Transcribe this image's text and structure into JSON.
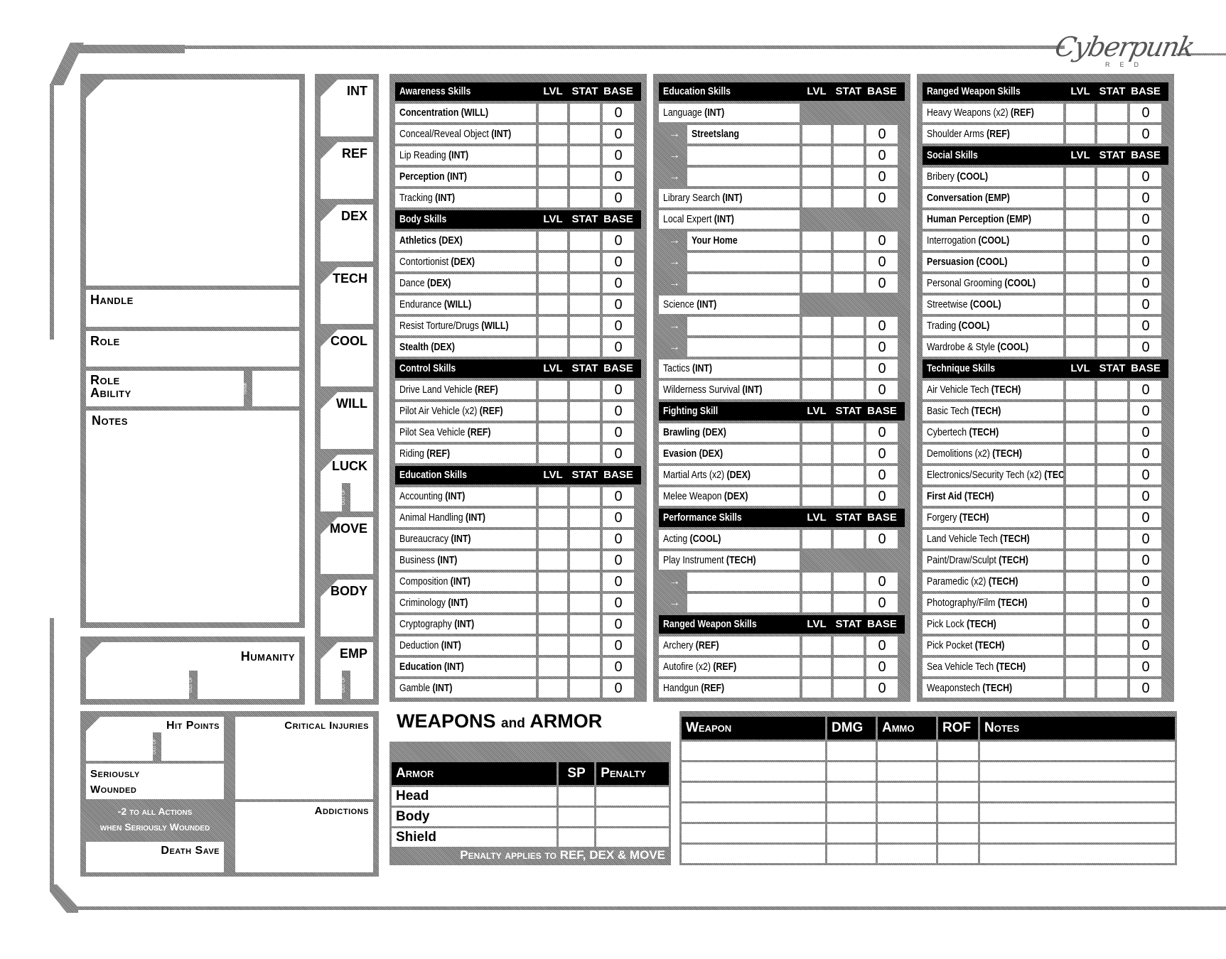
{
  "brand": {
    "logo": "Cyberpunk",
    "subtitle": "RED"
  },
  "character": {
    "handle_label": "Handle",
    "role_label": "Role",
    "role_ability_label": "Role Ability",
    "rank_label": "RANK",
    "notes_label": "Notes",
    "humanity_label": "Humanity",
    "out_of_label": "OUT OF"
  },
  "stats": [
    {
      "key": "INT",
      "out_of": false
    },
    {
      "key": "REF",
      "out_of": false
    },
    {
      "key": "DEX",
      "out_of": false
    },
    {
      "key": "TECH",
      "out_of": false
    },
    {
      "key": "COOL",
      "out_of": false
    },
    {
      "key": "WILL",
      "out_of": false
    },
    {
      "key": "LUCK",
      "out_of": true
    },
    {
      "key": "MOVE",
      "out_of": false
    },
    {
      "key": "BODY",
      "out_of": false
    },
    {
      "key": "EMP",
      "out_of": true
    }
  ],
  "columns_header": {
    "lvl": "LVL",
    "stat": "STAT",
    "base": "BASE"
  },
  "skill_columns": [
    [
      {
        "type": "header",
        "label": "Awareness Skills"
      },
      {
        "type": "skill",
        "name": "Concentration",
        "stat": "(WILL)",
        "bold": true,
        "base": "0"
      },
      {
        "type": "skill",
        "name": "Conceal/Reveal Object",
        "stat": "(INT)",
        "bold": false,
        "base": "0"
      },
      {
        "type": "skill",
        "name": "Lip Reading",
        "stat": "(INT)",
        "bold": false,
        "base": "0"
      },
      {
        "type": "skill",
        "name": "Perception",
        "stat": "(INT)",
        "bold": true,
        "base": "0"
      },
      {
        "type": "skill",
        "name": "Tracking",
        "stat": "(INT)",
        "bold": false,
        "base": "0"
      },
      {
        "type": "header",
        "label": "Body Skills"
      },
      {
        "type": "skill",
        "name": "Athletics",
        "stat": "(DEX)",
        "bold": true,
        "base": "0"
      },
      {
        "type": "skill",
        "name": "Contortionist",
        "stat": "(DEX)",
        "bold": false,
        "base": "0"
      },
      {
        "type": "skill",
        "name": "Dance",
        "stat": "(DEX)",
        "bold": false,
        "base": "0"
      },
      {
        "type": "skill",
        "name": "Endurance",
        "stat": "(WILL)",
        "bold": false,
        "base": "0"
      },
      {
        "type": "skill",
        "name": "Resist Torture/Drugs",
        "stat": "(WILL)",
        "bold": false,
        "base": "0"
      },
      {
        "type": "skill",
        "name": "Stealth",
        "stat": "(DEX)",
        "bold": true,
        "base": "0"
      },
      {
        "type": "header",
        "label": "Control Skills"
      },
      {
        "type": "skill",
        "name": "Drive Land Vehicle",
        "stat": "(REF)",
        "bold": false,
        "base": "0"
      },
      {
        "type": "skill",
        "name": "Pilot Air Vehicle (x2)",
        "stat": "(REF)",
        "bold": false,
        "base": "0"
      },
      {
        "type": "skill",
        "name": "Pilot Sea Vehicle",
        "stat": "(REF)",
        "bold": false,
        "base": "0"
      },
      {
        "type": "skill",
        "name": "Riding",
        "stat": "(REF)",
        "bold": false,
        "base": "0"
      },
      {
        "type": "header",
        "label": "Education Skills"
      },
      {
        "type": "skill",
        "name": "Accounting",
        "stat": "(INT)",
        "bold": false,
        "base": "0"
      },
      {
        "type": "skill",
        "name": "Animal Handling",
        "stat": "(INT)",
        "bold": false,
        "base": "0"
      },
      {
        "type": "skill",
        "name": "Bureaucracy",
        "stat": "(INT)",
        "bold": false,
        "base": "0"
      },
      {
        "type": "skill",
        "name": "Business",
        "stat": "(INT)",
        "bold": false,
        "base": "0"
      },
      {
        "type": "skill",
        "name": "Composition",
        "stat": "(INT)",
        "bold": false,
        "base": "0"
      },
      {
        "type": "skill",
        "name": "Criminology",
        "stat": "(INT)",
        "bold": false,
        "base": "0"
      },
      {
        "type": "skill",
        "name": "Cryptography",
        "stat": "(INT)",
        "bold": false,
        "base": "0"
      },
      {
        "type": "skill",
        "name": "Deduction",
        "stat": "(INT)",
        "bold": false,
        "base": "0"
      },
      {
        "type": "skill",
        "name": "Education",
        "stat": "(INT)",
        "bold": true,
        "base": "0"
      },
      {
        "type": "skill",
        "name": "Gamble",
        "stat": "(INT)",
        "bold": false,
        "base": "0"
      }
    ],
    [
      {
        "type": "header",
        "label": "Education Skills"
      },
      {
        "type": "parent",
        "name": "Language",
        "stat": "(INT)"
      },
      {
        "type": "sub",
        "name": "Streetslang",
        "base": "0"
      },
      {
        "type": "sub",
        "name": "",
        "base": "0"
      },
      {
        "type": "sub",
        "name": "",
        "base": "0"
      },
      {
        "type": "skill",
        "name": "Library Search",
        "stat": "(INT)",
        "bold": false,
        "base": "0"
      },
      {
        "type": "parent",
        "name": "Local Expert",
        "stat": "(INT)"
      },
      {
        "type": "sub",
        "name": "Your Home",
        "base": "0"
      },
      {
        "type": "sub",
        "name": "",
        "base": "0"
      },
      {
        "type": "sub",
        "name": "",
        "base": "0"
      },
      {
        "type": "parent",
        "name": "Science",
        "stat": "(INT)"
      },
      {
        "type": "sub",
        "name": "",
        "base": "0"
      },
      {
        "type": "sub",
        "name": "",
        "base": "0"
      },
      {
        "type": "skill",
        "name": "Tactics",
        "stat": "(INT)",
        "bold": false,
        "base": "0"
      },
      {
        "type": "skill",
        "name": "Wilderness Survival",
        "stat": "(INT)",
        "bold": false,
        "base": "0"
      },
      {
        "type": "header",
        "label": "Fighting Skill"
      },
      {
        "type": "skill",
        "name": "Brawling",
        "stat": "(DEX)",
        "bold": true,
        "base": "0"
      },
      {
        "type": "skill",
        "name": "Evasion",
        "stat": "(DEX)",
        "bold": true,
        "base": "0"
      },
      {
        "type": "skill",
        "name": "Martial Arts (x2)",
        "stat": "(DEX)",
        "bold": false,
        "base": "0"
      },
      {
        "type": "skill",
        "name": "Melee Weapon",
        "stat": "(DEX)",
        "bold": false,
        "base": "0"
      },
      {
        "type": "header",
        "label": "Performance Skills"
      },
      {
        "type": "skill",
        "name": "Acting",
        "stat": "(COOL)",
        "bold": false,
        "base": "0"
      },
      {
        "type": "parent",
        "name": "Play Instrument",
        "stat": "(TECH)"
      },
      {
        "type": "sub",
        "name": "",
        "base": "0"
      },
      {
        "type": "sub",
        "name": "",
        "base": "0"
      },
      {
        "type": "header",
        "label": "Ranged Weapon Skills"
      },
      {
        "type": "skill",
        "name": "Archery",
        "stat": "(REF)",
        "bold": false,
        "base": "0"
      },
      {
        "type": "skill",
        "name": "Autofire (x2)",
        "stat": "(REF)",
        "bold": false,
        "base": "0"
      },
      {
        "type": "skill",
        "name": "Handgun",
        "stat": "(REF)",
        "bold": false,
        "base": "0"
      }
    ],
    [
      {
        "type": "header",
        "label": "Ranged Weapon Skills"
      },
      {
        "type": "skill",
        "name": "Heavy Weapons (x2)",
        "stat": "(REF)",
        "bold": false,
        "base": "0"
      },
      {
        "type": "skill",
        "name": "Shoulder Arms",
        "stat": "(REF)",
        "bold": false,
        "base": "0"
      },
      {
        "type": "header",
        "label": "Social Skills"
      },
      {
        "type": "skill",
        "name": "Bribery",
        "stat": "(COOL)",
        "bold": false,
        "base": "0"
      },
      {
        "type": "skill",
        "name": "Conversation",
        "stat": "(EMP)",
        "bold": true,
        "base": "0"
      },
      {
        "type": "skill",
        "name": "Human Perception",
        "stat": "(EMP)",
        "bold": true,
        "base": "0"
      },
      {
        "type": "skill",
        "name": "Interrogation",
        "stat": "(COOL)",
        "bold": false,
        "base": "0"
      },
      {
        "type": "skill",
        "name": "Persuasion",
        "stat": "(COOL)",
        "bold": true,
        "base": "0"
      },
      {
        "type": "skill",
        "name": "Personal Grooming",
        "stat": "(COOL)",
        "bold": false,
        "base": "0"
      },
      {
        "type": "skill",
        "name": "Streetwise",
        "stat": "(COOL)",
        "bold": false,
        "base": "0"
      },
      {
        "type": "skill",
        "name": "Trading",
        "stat": "(COOL)",
        "bold": false,
        "base": "0"
      },
      {
        "type": "skill",
        "name": "Wardrobe & Style",
        "stat": "(COOL)",
        "bold": false,
        "base": "0"
      },
      {
        "type": "header",
        "label": "Technique Skills"
      },
      {
        "type": "skill",
        "name": "Air Vehicle Tech",
        "stat": "(TECH)",
        "bold": false,
        "base": "0"
      },
      {
        "type": "skill",
        "name": "Basic Tech",
        "stat": "(TECH)",
        "bold": false,
        "base": "0"
      },
      {
        "type": "skill",
        "name": "Cybertech",
        "stat": "(TECH)",
        "bold": false,
        "base": "0"
      },
      {
        "type": "skill",
        "name": "Demolitions (x2)",
        "stat": "(TECH)",
        "bold": false,
        "base": "0"
      },
      {
        "type": "skill",
        "name": "Electronics/Security Tech (x2)",
        "stat": "(TECH)",
        "bold": false,
        "base": "0"
      },
      {
        "type": "skill",
        "name": "First Aid",
        "stat": "(TECH)",
        "bold": true,
        "base": "0"
      },
      {
        "type": "skill",
        "name": "Forgery",
        "stat": "(TECH)",
        "bold": false,
        "base": "0"
      },
      {
        "type": "skill",
        "name": "Land Vehicle Tech",
        "stat": "(TECH)",
        "bold": false,
        "base": "0"
      },
      {
        "type": "skill",
        "name": "Paint/Draw/Sculpt",
        "stat": "(TECH)",
        "bold": false,
        "base": "0"
      },
      {
        "type": "skill",
        "name": "Paramedic (x2)",
        "stat": "(TECH)",
        "bold": false,
        "base": "0"
      },
      {
        "type": "skill",
        "name": "Photography/Film",
        "stat": "(TECH)",
        "bold": false,
        "base": "0"
      },
      {
        "type": "skill",
        "name": "Pick Lock",
        "stat": "(TECH)",
        "bold": false,
        "base": "0"
      },
      {
        "type": "skill",
        "name": "Pick Pocket",
        "stat": "(TECH)",
        "bold": false,
        "base": "0"
      },
      {
        "type": "skill",
        "name": "Sea Vehicle Tech",
        "stat": "(TECH)",
        "bold": false,
        "base": "0"
      },
      {
        "type": "skill",
        "name": "Weaponstech",
        "stat": "(TECH)",
        "bold": false,
        "base": "0"
      }
    ]
  ],
  "health": {
    "hit_points_label": "Hit Points",
    "seriously_wounded_label": "Seriously Wounded",
    "penalty_note_line1": "-2 to all Actions",
    "penalty_note_line2": "when Seriously Wounded",
    "death_save_label": "Death Save",
    "critical_injuries_label": "Critical Injuries",
    "addictions_label": "Addictions",
    "out_of_label": "OUT OF"
  },
  "weapons_armor": {
    "title_main1": "WEAPONS",
    "title_small": "and",
    "title_main2": "ARMOR",
    "armor_headers": [
      "Armor",
      "SP",
      "Penalty"
    ],
    "armor_rows": [
      "Head",
      "Body",
      "Shield"
    ],
    "armor_note": "Penalty applies to REF, DEX & MOVE",
    "weapon_headers": [
      "Weapon",
      "DMG",
      "Ammo",
      "ROF",
      "Notes"
    ],
    "weapon_row_count": 6
  }
}
